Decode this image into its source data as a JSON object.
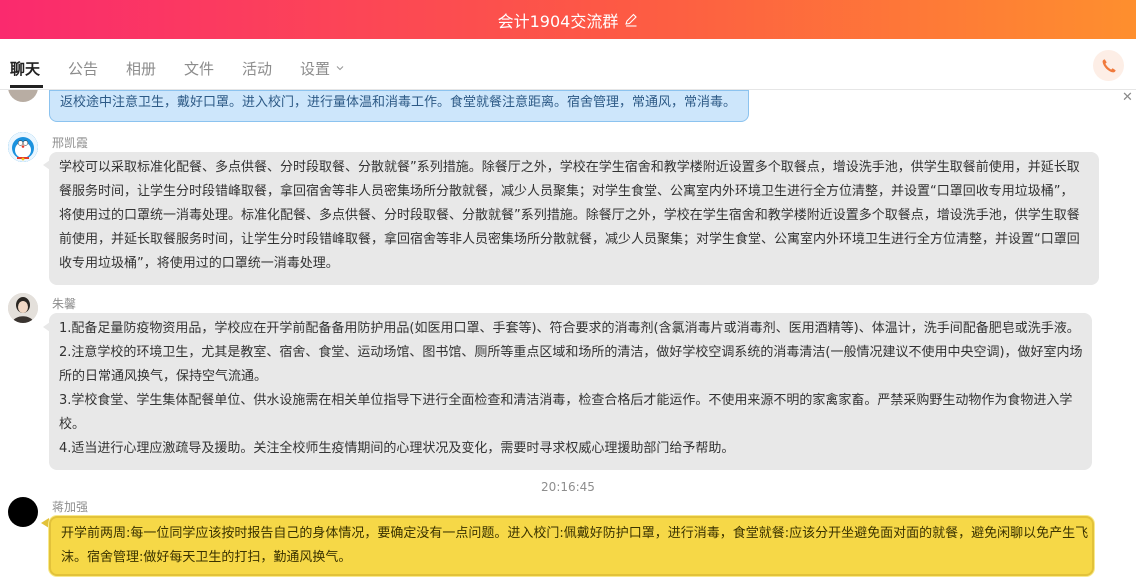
{
  "window": {
    "title": "会计1904交流群"
  },
  "tabs": [
    {
      "label": "聊天",
      "active": true
    },
    {
      "label": "公告",
      "active": false
    },
    {
      "label": "相册",
      "active": false
    },
    {
      "label": "文件",
      "active": false
    },
    {
      "label": "活动",
      "active": false
    },
    {
      "label": "设置",
      "active": false
    }
  ],
  "colors": {
    "header_gradient_start": "#fa2a6e",
    "header_gradient_end": "#fe8f2e",
    "highlight_bubble": "#f6d847",
    "self_bubble": "#cde6fb"
  },
  "messages": [
    {
      "type": "self",
      "lines": [
        "返校途中注意卫生，戴好口罩。进入校门，进行量体温和消毒工作。食堂就餐注意距离。宿舍管理，常通风，常消毒。"
      ]
    },
    {
      "sender": "邢凯霞",
      "avatar_icon": "doraemon-avatar-icon",
      "lines": [
        "学校可以采取标准化配餐、多点供餐、分时段取餐、分散就餐”系列措施。除餐厅之外，学校在学生宿舍和教学楼附近设置多个取餐点，增设洗手池，供学生取餐前使用，并延长取",
        "餐服务时间，让学生分时段错峰取餐，拿回宿舍等非人员密集场所分散就餐，减少人员聚集；对学生食堂、公寓室内外环境卫生进行全方位清整，并设置“口罩回收专用垃圾桶”，",
        "将使用过的口罩统一消毒处理。标准化配餐、多点供餐、分时段取餐、分散就餐”系列措施。除餐厅之外，学校在学生宿舍和教学楼附近设置多个取餐点，增设洗手池，供学生取餐",
        "前使用，并延长取餐服务时间，让学生分时段错峰取餐，拿回宿舍等非人员密集场所分散就餐，减少人员聚集；对学生食堂、公寓室内外环境卫生进行全方位清整，并设置“口罩回",
        "收专用垃圾桶”，将使用过的口罩统一消毒处理。"
      ]
    },
    {
      "sender": "朱馨",
      "avatar_icon": "portrait-avatar-icon",
      "lines": [
        "1.配备足量防疫物资用品，学校应在开学前配备备用防护用品(如医用口罩、手套等)、符合要求的消毒剂(含氯消毒片或消毒剂、医用酒精等)、体温计，洗手间配备肥皂或洗手液。",
        "2.注意学校的环境卫生，尤其是教室、宿舍、食堂、运动场馆、图书馆、厕所等重点区域和场所的清洁，做好学校空调系统的消毒清洁(一般情况建议不使用中央空调)，做好室内场",
        "所的日常通风换气，保持空气流通。",
        "3.学校食堂、学生集体配餐单位、供水设施需在相关单位指导下进行全面检查和清洁消毒，检查合格后才能运作。不使用来源不明的家禽家畜。严禁采购野生动物作为食物进入学",
        "校。",
        "4.适当进行心理应激疏导及援助。关注全校师生疫情期间的心理状况及变化，需要时寻求权威心理援助部门给予帮助。"
      ]
    },
    {
      "timestamp": "20:16:45"
    },
    {
      "sender": "蒋加强",
      "avatar_icon": "black-circle-avatar-icon",
      "highlighted": true,
      "lines": [
        "开学前两周:每一位同学应该按时报告自己的身体情况，要确定没有一点问题。进入校门:佩戴好防护口罩，进行消毒，食堂就餐:应该分开坐避免面对面的就餐，避免闲聊以免产生飞",
        "沫。宿舍管理:做好每天卫生的打扫，勤通风换气。"
      ]
    }
  ]
}
